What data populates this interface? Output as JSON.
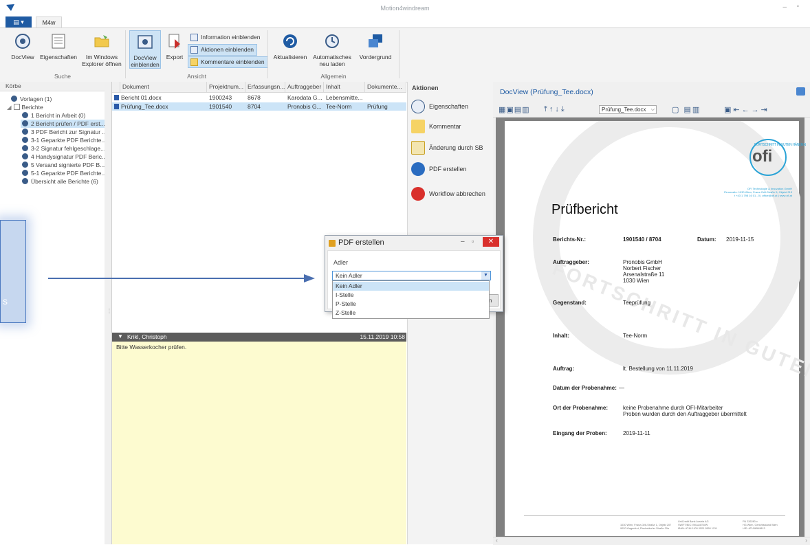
{
  "window": {
    "title": "Motion4windream"
  },
  "tabs": {
    "file_label": "▤ ▾",
    "m4w_label": "M4w"
  },
  "ribbon": {
    "suche": {
      "label": "Suche",
      "docview": "DocView",
      "eigenschaften": "Eigenschaften",
      "explorer_line1": "Im Windows",
      "explorer_line2": "Explorer öffnen"
    },
    "ansicht": {
      "label": "Ansicht",
      "docview_line1": "DocView",
      "docview_line2": "einblenden",
      "export": "Export",
      "information": "Information einblenden",
      "aktionen": "Aktionen einblenden",
      "kommentare": "Kommentare einblenden"
    },
    "allgemein": {
      "label": "Allgemein",
      "aktualisieren": "Aktualisieren",
      "auto_line1": "Automatisches",
      "auto_line2": "neu laden",
      "vordergrund": "Vordergrund"
    }
  },
  "left_panel": {
    "header": "Körbe",
    "items": [
      {
        "label": "Vorlagen (1)"
      },
      {
        "label": "Berichte"
      },
      {
        "label": "1 Bericht in Arbeit (0)"
      },
      {
        "label": "2 Bericht prüfen / PDF erst..."
      },
      {
        "label": "3 PDF Bericht zur Signatur ..."
      },
      {
        "label": "3-1 Geparkte PDF Berichte..."
      },
      {
        "label": "3-2 Signatur fehlgeschlage..."
      },
      {
        "label": "4 Handysignatur PDF Beric..."
      },
      {
        "label": "5 Versand signierte PDF B..."
      },
      {
        "label": "5-1 Geparkte PDF Berichte..."
      },
      {
        "label": "Übersicht alle Berichte (6)"
      }
    ]
  },
  "grid": {
    "columns": [
      "Dokument",
      "Projektnum...",
      "Erfassungsn...",
      "Auftraggeber",
      "Inhalt",
      "Dokumente..."
    ],
    "rows": [
      [
        "Bericht 01.docx",
        "1900243",
        "8678",
        "Karodata G...",
        "Lebensmitte...",
        ""
      ],
      [
        "Prüfung_Tee.docx",
        "1901540",
        "8704",
        "Pronobis G...",
        "Tee-Norm",
        "Prüfung"
      ]
    ]
  },
  "comment": {
    "author": "Krikl, Christoph",
    "timestamp": "15.11.2019 10:58",
    "text": "Bitte Wasserkocher prüfen."
  },
  "actions": {
    "header": "Aktionen",
    "items": [
      "Eigenschaften",
      "Kommentar",
      "Änderung durch SB",
      "PDF erstellen",
      "Workflow abbrechen"
    ]
  },
  "docview": {
    "title": "DocView (Prüfung_Tee.docx)",
    "file_select": "Prüfung_Tee.docx",
    "page": {
      "logo": "ofi",
      "logo_ring": "FORTSCHRITT IN GUTEN HÄNDEN",
      "watermark": "FORTSCHRITT IN GUTEN HÄNDEN",
      "company_line1": "OFI Technologie & Innovation GmbH",
      "company_line2": "Firmensitz: 1030 Wien, Franz-Grill-Straße 5, Objekt 213",
      "company_line3": "t +43 1 798 16 01 - 0 | office@ofi.at | www.ofi.at",
      "heading": "Prüfbericht",
      "berichts_label": "Berichts-Nr.:",
      "berichts_value": "1901540 / 8704",
      "datum_label": "Datum:",
      "datum_value": "2019-11-15",
      "auftraggeber_label": "Auftraggeber:",
      "auftraggeber_lines": [
        "Pronobis GmbH",
        "Norbert Fischer",
        "Arsenalstraße 11",
        "1030 Wien"
      ],
      "gegenstand_label": "Gegenstand:",
      "gegenstand_value": "Teeprüfung",
      "inhalt_label": "Inhalt:",
      "inhalt_value": "Tee-Norm",
      "auftrag_label": "Auftrag:",
      "auftrag_value": "lt. Bestellung von 11.11.2019",
      "datum_probe_label": "Datum der Probenahme:",
      "datum_probe_value": "—",
      "ort_label": "Ort der Probenahme:",
      "ort_lines": [
        "keine Probenahme durch OFI-Mitarbeiter",
        "Proben wurden durch den Auftraggeber übermittelt"
      ],
      "eingang_label": "Eingang der Proben:",
      "eingang_value": "2019-11-11",
      "footer_col1": [
        "1030 Wien, Franz-Grill-Straße 1, Objekt 207",
        "9020 Klagenfurt, Pischeldorfer Straße 20a"
      ],
      "footer_col2": [
        "UniCredit Bank Austria AG",
        "SWIFT/BIC: BKAUATWW",
        "IBAN: AT44 1100 0520 9550 1211"
      ],
      "footer_col3": [
        "FN 226280 x",
        "HG Wien, Gerichtsstand Wien",
        "UID: ATU56549813"
      ]
    }
  },
  "callout": {
    "text": "s"
  },
  "dialog": {
    "title": "PDF erstellen",
    "field_label": "Adler",
    "selected": "Kein Adler",
    "options": [
      "Kein Adler",
      "I-Stelle",
      "P-Stelle",
      "Z-Stelle"
    ],
    "button_fragment": "n"
  }
}
